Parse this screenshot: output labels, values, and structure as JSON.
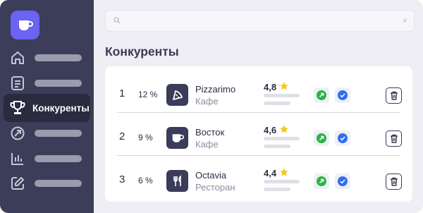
{
  "sidebar": {
    "active_label": "Конкуренты",
    "items": [
      {
        "icon": "home-icon"
      },
      {
        "icon": "document-icon"
      },
      {
        "icon": "trophy-icon",
        "label": "Конкуренты",
        "active": true
      },
      {
        "icon": "growth-icon"
      },
      {
        "icon": "bar-chart-icon"
      },
      {
        "icon": "edit-icon"
      }
    ]
  },
  "search": {
    "value": "",
    "placeholder": ""
  },
  "main": {
    "title": "Конкуренты"
  },
  "competitors": [
    {
      "rank": "1",
      "percent": "12 %",
      "name": "Pizzarimo",
      "type": "Кафе",
      "rating": "4,8",
      "icon": "pizza-icon"
    },
    {
      "rank": "2",
      "percent": "9 %",
      "name": "Восток",
      "type": "Кафе",
      "rating": "4,6",
      "icon": "coffee-cup-icon"
    },
    {
      "rank": "3",
      "percent": "6 %",
      "name": "Octavia",
      "type": "Ресторан",
      "rating": "4,4",
      "icon": "fork-knife-icon"
    }
  ],
  "colors": {
    "sidebar_bg": "#3c3d59",
    "sidebar_active": "#2a2b3f",
    "logo_bg": "#6b63f1",
    "star": "#f5c518",
    "trend_green": "#2cb34a",
    "verified_blue": "#2f6ef0"
  }
}
